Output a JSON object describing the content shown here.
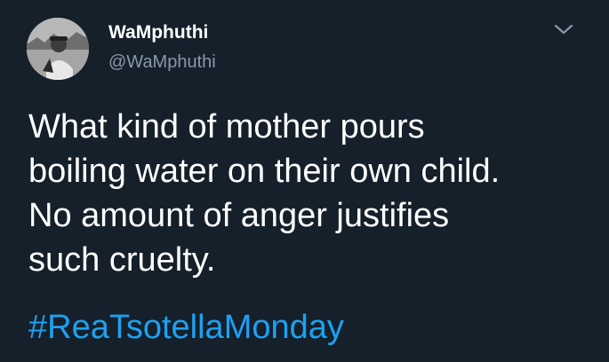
{
  "tweet": {
    "author": {
      "display_name": "WaMphuthi",
      "handle": "@WaMphuthi",
      "avatar_icon": "user-avatar-photo"
    },
    "menu_icon": "chevron-down-icon",
    "text_lines": [
      "What kind of mother pours",
      "boiling water on their own child.",
      "No amount of anger justifies",
      "such cruelty."
    ],
    "hashtag": "#ReaTsotellaMonday"
  },
  "colors": {
    "background": "#15202b",
    "text_primary": "#ffffff",
    "text_secondary": "#8899a6",
    "link": "#1da1f2"
  }
}
